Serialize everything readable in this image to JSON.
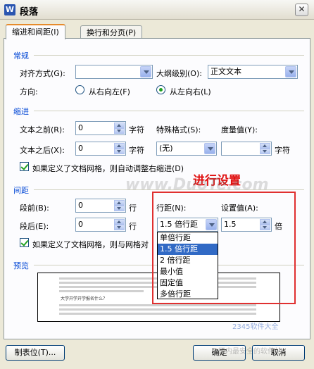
{
  "window": {
    "title": "段落",
    "icon_letter": "W",
    "close_glyph": "✕"
  },
  "tabs": [
    {
      "label": "缩进和间距(I)"
    },
    {
      "label": "换行和分页(P)"
    }
  ],
  "general": {
    "section": "常规",
    "alignment_label": "对齐方式(G):",
    "alignment_value": "",
    "outline_label": "大纲级别(O):",
    "outline_value": "正文文本",
    "direction_label": "方向:",
    "rtl_label": "从右向左(F)",
    "ltr_label": "从左向右(L)"
  },
  "indent": {
    "section": "缩进",
    "before_label": "文本之前(R):",
    "before_value": "0",
    "before_unit": "字符",
    "special_label": "特殊格式(S):",
    "special_value": "(无)",
    "measure_label": "度量值(Y):",
    "measure_value": "",
    "measure_unit": "字符",
    "after_label": "文本之后(X):",
    "after_value": "0",
    "after_unit": "字符",
    "grid_check_label": "如果定义了文档网格，则自动调整右缩进(D)"
  },
  "spacing": {
    "section": "间距",
    "before_label": "段前(B):",
    "before_value": "0",
    "before_unit": "行",
    "after_label": "段后(E):",
    "after_value": "0",
    "after_unit": "行",
    "line_label": "行距(N):",
    "line_value": "1.5 倍行距",
    "set_label": "设置值(A):",
    "set_value": "1.5",
    "set_unit": "倍",
    "grid_check_label": "如果定义了文档网格，则与网格对"
  },
  "line_options": [
    "单倍行距",
    "1.5 倍行距",
    "2 倍行距",
    "最小值",
    "固定值",
    "多倍行距"
  ],
  "preview": {
    "section": "预览",
    "sample_text": "大学开学开学报名什么？"
  },
  "annotation": {
    "text": "进行设置"
  },
  "watermark": {
    "main": "www.DuoTe.com",
    "logo": "2345软件大全",
    "sub": "国内最安全的软件站"
  },
  "buttons": {
    "tabs": "制表位(T)...",
    "ok": "确定",
    "cancel": "取消"
  }
}
